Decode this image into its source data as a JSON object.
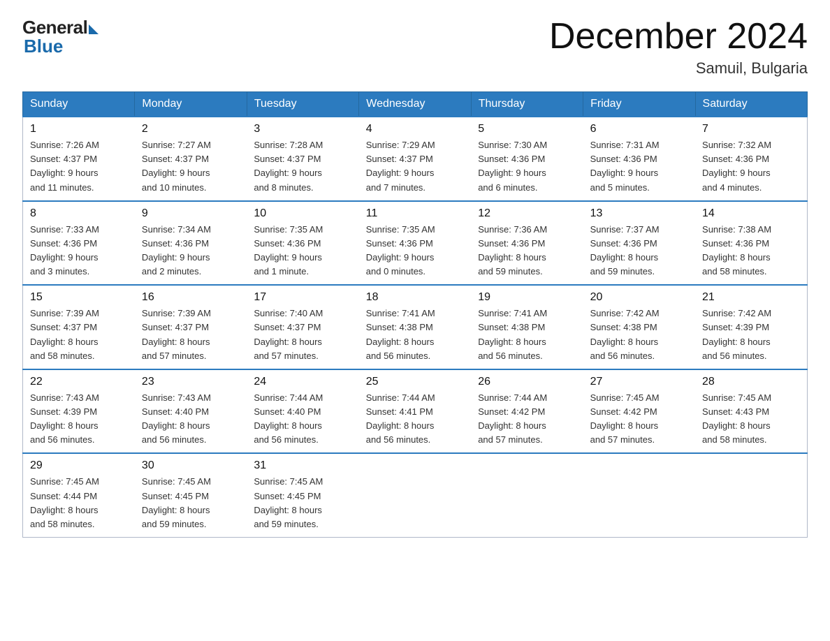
{
  "logo": {
    "general": "General",
    "blue": "Blue"
  },
  "header": {
    "month": "December 2024",
    "location": "Samuil, Bulgaria"
  },
  "days_of_week": [
    "Sunday",
    "Monday",
    "Tuesday",
    "Wednesday",
    "Thursday",
    "Friday",
    "Saturday"
  ],
  "weeks": [
    [
      {
        "day": "1",
        "sunrise": "7:26 AM",
        "sunset": "4:37 PM",
        "daylight": "9 hours and 11 minutes."
      },
      {
        "day": "2",
        "sunrise": "7:27 AM",
        "sunset": "4:37 PM",
        "daylight": "9 hours and 10 minutes."
      },
      {
        "day": "3",
        "sunrise": "7:28 AM",
        "sunset": "4:37 PM",
        "daylight": "9 hours and 8 minutes."
      },
      {
        "day": "4",
        "sunrise": "7:29 AM",
        "sunset": "4:37 PM",
        "daylight": "9 hours and 7 minutes."
      },
      {
        "day": "5",
        "sunrise": "7:30 AM",
        "sunset": "4:36 PM",
        "daylight": "9 hours and 6 minutes."
      },
      {
        "day": "6",
        "sunrise": "7:31 AM",
        "sunset": "4:36 PM",
        "daylight": "9 hours and 5 minutes."
      },
      {
        "day": "7",
        "sunrise": "7:32 AM",
        "sunset": "4:36 PM",
        "daylight": "9 hours and 4 minutes."
      }
    ],
    [
      {
        "day": "8",
        "sunrise": "7:33 AM",
        "sunset": "4:36 PM",
        "daylight": "9 hours and 3 minutes."
      },
      {
        "day": "9",
        "sunrise": "7:34 AM",
        "sunset": "4:36 PM",
        "daylight": "9 hours and 2 minutes."
      },
      {
        "day": "10",
        "sunrise": "7:35 AM",
        "sunset": "4:36 PM",
        "daylight": "9 hours and 1 minute."
      },
      {
        "day": "11",
        "sunrise": "7:35 AM",
        "sunset": "4:36 PM",
        "daylight": "9 hours and 0 minutes."
      },
      {
        "day": "12",
        "sunrise": "7:36 AM",
        "sunset": "4:36 PM",
        "daylight": "8 hours and 59 minutes."
      },
      {
        "day": "13",
        "sunrise": "7:37 AM",
        "sunset": "4:36 PM",
        "daylight": "8 hours and 59 minutes."
      },
      {
        "day": "14",
        "sunrise": "7:38 AM",
        "sunset": "4:36 PM",
        "daylight": "8 hours and 58 minutes."
      }
    ],
    [
      {
        "day": "15",
        "sunrise": "7:39 AM",
        "sunset": "4:37 PM",
        "daylight": "8 hours and 58 minutes."
      },
      {
        "day": "16",
        "sunrise": "7:39 AM",
        "sunset": "4:37 PM",
        "daylight": "8 hours and 57 minutes."
      },
      {
        "day": "17",
        "sunrise": "7:40 AM",
        "sunset": "4:37 PM",
        "daylight": "8 hours and 57 minutes."
      },
      {
        "day": "18",
        "sunrise": "7:41 AM",
        "sunset": "4:38 PM",
        "daylight": "8 hours and 56 minutes."
      },
      {
        "day": "19",
        "sunrise": "7:41 AM",
        "sunset": "4:38 PM",
        "daylight": "8 hours and 56 minutes."
      },
      {
        "day": "20",
        "sunrise": "7:42 AM",
        "sunset": "4:38 PM",
        "daylight": "8 hours and 56 minutes."
      },
      {
        "day": "21",
        "sunrise": "7:42 AM",
        "sunset": "4:39 PM",
        "daylight": "8 hours and 56 minutes."
      }
    ],
    [
      {
        "day": "22",
        "sunrise": "7:43 AM",
        "sunset": "4:39 PM",
        "daylight": "8 hours and 56 minutes."
      },
      {
        "day": "23",
        "sunrise": "7:43 AM",
        "sunset": "4:40 PM",
        "daylight": "8 hours and 56 minutes."
      },
      {
        "day": "24",
        "sunrise": "7:44 AM",
        "sunset": "4:40 PM",
        "daylight": "8 hours and 56 minutes."
      },
      {
        "day": "25",
        "sunrise": "7:44 AM",
        "sunset": "4:41 PM",
        "daylight": "8 hours and 56 minutes."
      },
      {
        "day": "26",
        "sunrise": "7:44 AM",
        "sunset": "4:42 PM",
        "daylight": "8 hours and 57 minutes."
      },
      {
        "day": "27",
        "sunrise": "7:45 AM",
        "sunset": "4:42 PM",
        "daylight": "8 hours and 57 minutes."
      },
      {
        "day": "28",
        "sunrise": "7:45 AM",
        "sunset": "4:43 PM",
        "daylight": "8 hours and 58 minutes."
      }
    ],
    [
      {
        "day": "29",
        "sunrise": "7:45 AM",
        "sunset": "4:44 PM",
        "daylight": "8 hours and 58 minutes."
      },
      {
        "day": "30",
        "sunrise": "7:45 AM",
        "sunset": "4:45 PM",
        "daylight": "8 hours and 59 minutes."
      },
      {
        "day": "31",
        "sunrise": "7:45 AM",
        "sunset": "4:45 PM",
        "daylight": "8 hours and 59 minutes."
      },
      null,
      null,
      null,
      null
    ]
  ],
  "labels": {
    "sunrise": "Sunrise:",
    "sunset": "Sunset:",
    "daylight": "Daylight:"
  }
}
